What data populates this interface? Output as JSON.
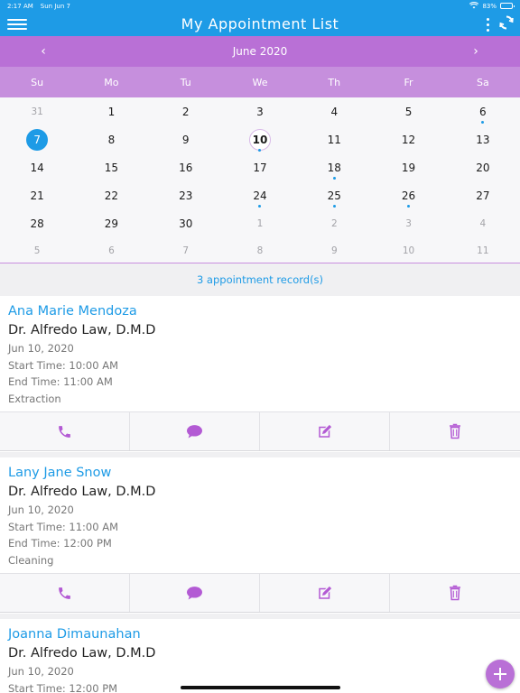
{
  "status_bar": {
    "time": "2:17 AM",
    "date": "Sun Jun 7",
    "battery": "83%",
    "battery_level": 0.83
  },
  "nav": {
    "title": "My Appointment List",
    "menu_icon": "hamburger-icon",
    "more_icon": "kebab-icon",
    "refresh_icon": "refresh-icon"
  },
  "calendar": {
    "month_title": "June 2020",
    "prev_label": "‹",
    "next_label": "›",
    "weekdays": [
      "Su",
      "Mo",
      "Tu",
      "We",
      "Th",
      "Fr",
      "Sa"
    ],
    "weeks": [
      [
        {
          "d": "31",
          "m": true
        },
        {
          "d": "1"
        },
        {
          "d": "2"
        },
        {
          "d": "3"
        },
        {
          "d": "4"
        },
        {
          "d": "5"
        },
        {
          "d": "6",
          "dot": true
        }
      ],
      [
        {
          "d": "7",
          "sel": true
        },
        {
          "d": "8"
        },
        {
          "d": "9"
        },
        {
          "d": "10",
          "today": true,
          "dot": true
        },
        {
          "d": "11"
        },
        {
          "d": "12"
        },
        {
          "d": "13"
        }
      ],
      [
        {
          "d": "14"
        },
        {
          "d": "15"
        },
        {
          "d": "16"
        },
        {
          "d": "17"
        },
        {
          "d": "18",
          "dot": true
        },
        {
          "d": "19"
        },
        {
          "d": "20"
        }
      ],
      [
        {
          "d": "21"
        },
        {
          "d": "22"
        },
        {
          "d": "23"
        },
        {
          "d": "24",
          "dot": true
        },
        {
          "d": "25",
          "dot": true
        },
        {
          "d": "26",
          "dot": true
        },
        {
          "d": "27"
        }
      ],
      [
        {
          "d": "28"
        },
        {
          "d": "29"
        },
        {
          "d": "30"
        },
        {
          "d": "1",
          "m": true
        },
        {
          "d": "2",
          "m": true
        },
        {
          "d": "3",
          "m": true
        },
        {
          "d": "4",
          "m": true
        }
      ],
      [
        {
          "d": "5",
          "m": true
        },
        {
          "d": "6",
          "m": true
        },
        {
          "d": "7",
          "m": true
        },
        {
          "d": "8",
          "m": true
        },
        {
          "d": "9",
          "m": true
        },
        {
          "d": "10",
          "m": true
        },
        {
          "d": "11",
          "m": true
        }
      ]
    ]
  },
  "records_text": "3 appointment record(s)",
  "appointments": [
    {
      "patient": "Ana Marie Mendoza",
      "doctor": "Dr. Alfredo Law, D.M.D",
      "date": "Jun 10, 2020",
      "start": "Start Time: 10:00 AM",
      "end": "End Time: 11:00 AM",
      "procedure": "Extraction"
    },
    {
      "patient": "Lany Jane Snow",
      "doctor": "Dr. Alfredo Law, D.M.D",
      "date": "Jun 10, 2020",
      "start": "Start Time: 11:00 AM",
      "end": "End Time: 12:00 PM",
      "procedure": "Cleaning"
    },
    {
      "patient": "Joanna Dimaunahan",
      "doctor": "Dr. Alfredo Law, D.M.D",
      "date": "Jun 10, 2020",
      "start": "Start Time: 12:00 PM",
      "end": "",
      "procedure": ""
    }
  ],
  "action_icons": [
    "phone-icon",
    "chat-icon",
    "edit-icon",
    "trash-icon"
  ],
  "fab_icon": "plus-icon",
  "colors": {
    "primary_blue": "#1e9be6",
    "purple": "#b970d6",
    "purple_light": "#c68fdd",
    "action_purple": "#b35ad4"
  }
}
